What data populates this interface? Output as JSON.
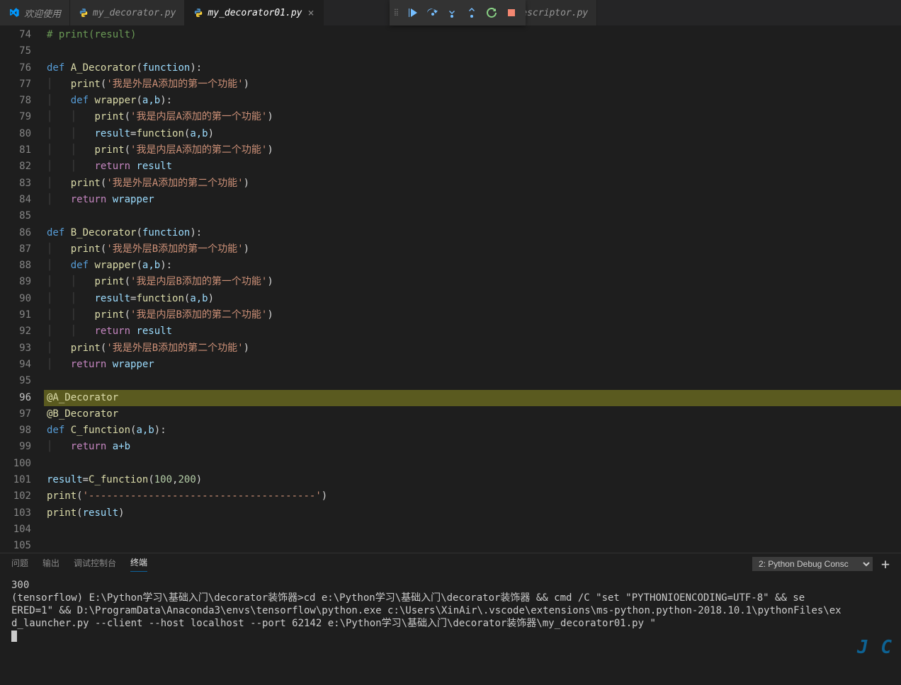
{
  "tabs": [
    {
      "label": "欢迎使用",
      "kind": "vscode"
    },
    {
      "label": "my_decorator.py",
      "kind": "py"
    },
    {
      "label": "my_decorator01.py",
      "kind": "py",
      "active": true,
      "close": "×"
    },
    {
      "label": "descriptor.py",
      "kind": "py"
    }
  ],
  "lineNumbers": [
    "74",
    "75",
    "76",
    "77",
    "78",
    "79",
    "80",
    "81",
    "82",
    "83",
    "84",
    "85",
    "86",
    "87",
    "88",
    "89",
    "90",
    "91",
    "92",
    "93",
    "94",
    "95",
    "96",
    "97",
    "98",
    "99",
    "100",
    "101",
    "102",
    "103",
    "104",
    "105"
  ],
  "execLine": "96",
  "code": {
    "l74": "# print(result)",
    "defA": {
      "def": "def",
      "name": "A_Decorator",
      "args": "function"
    },
    "p77": {
      "fn": "print",
      "s": "'我是外层A添加的第一个功能'"
    },
    "defW": {
      "def": "def",
      "name": "wrapper",
      "args": "a,b"
    },
    "p79": {
      "fn": "print",
      "s": "'我是内层A添加的第一个功能'"
    },
    "l80": {
      "v": "result",
      "fn": "function",
      "args": "a,b"
    },
    "p81": {
      "fn": "print",
      "s": "'我是内层A添加的第二个功能'"
    },
    "l82": {
      "ret": "return",
      "v": "result"
    },
    "p83": {
      "fn": "print",
      "s": "'我是外层A添加的第二个功能'"
    },
    "l84": {
      "ret": "return",
      "v": "wrapper"
    },
    "defB": {
      "def": "def",
      "name": "B_Decorator",
      "args": "function"
    },
    "p87": {
      "fn": "print",
      "s": "'我是外层B添加的第一个功能'"
    },
    "p89": {
      "fn": "print",
      "s": "'我是内层B添加的第一个功能'"
    },
    "l90": {
      "v": "result",
      "fn": "function",
      "args": "a,b"
    },
    "p91": {
      "fn": "print",
      "s": "'我是内层B添加的第二个功能'"
    },
    "l92": {
      "ret": "return",
      "v": "result"
    },
    "p93": {
      "fn": "print",
      "s": "'我是外层B添加的第二个功能'"
    },
    "l94": {
      "ret": "return",
      "v": "wrapper"
    },
    "decA": "@A_Decorator",
    "decB": "@B_Decorator",
    "defC": {
      "def": "def",
      "name": "C_function",
      "args": "a,b"
    },
    "l99": {
      "ret": "return",
      "expr": "a+b"
    },
    "l101": {
      "v": "result",
      "fn": "C_function",
      "n1": "100",
      "n2": "200"
    },
    "l102": {
      "fn": "print",
      "s": "'--------------------------------------'"
    },
    "l103": {
      "fn": "print",
      "v": "result"
    }
  },
  "panel": {
    "tabs": [
      "问题",
      "输出",
      "调试控制台",
      "终端"
    ],
    "activeTab": "终端",
    "selector": "2: Python Debug Consc",
    "plus": "+"
  },
  "terminal": {
    "l1": "300",
    "l2": "",
    "l3a": "(tensorflow) E:\\Python学习\\基础入门\\decorator装饰器>cd e:\\Python学习\\基础入门\\decorator装饰器 && cmd /C \"set \"PYTHONIOENCODING=UTF-8\" && se",
    "l3b": "ERED=1\" && D:\\ProgramData\\Anaconda3\\envs\\tensorflow\\python.exe c:\\Users\\XinAir\\.vscode\\extensions\\ms-python.python-2018.10.1\\pythonFiles\\ex",
    "l3c": "d_launcher.py --client --host localhost --port 62142 e:\\Python学习\\基础入门\\decorator装饰器\\my_decorator01.py \""
  },
  "watermark": "J   C"
}
